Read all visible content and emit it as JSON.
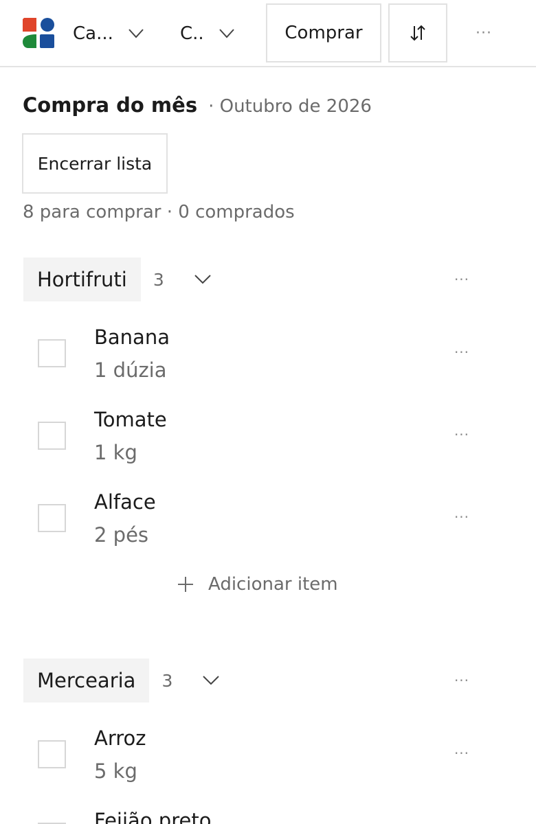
{
  "header": {
    "dropdown1_label": "Ca...",
    "dropdown2_label": "C..",
    "buy_button": "Comprar",
    "sort_icon": "sort-icon",
    "more_label": "···"
  },
  "list": {
    "title": "Compra do mês",
    "subtitle": "· Outubro de 2026",
    "close_button": "Encerrar lista",
    "summary": "8 para comprar · 0 comprados"
  },
  "groups": [
    {
      "name": "Hortifruti",
      "count": "3",
      "items": [
        {
          "name": "Banana",
          "qty": "1 dúzia"
        },
        {
          "name": "Tomate",
          "qty": "1 kg"
        },
        {
          "name": "Alface",
          "qty": "2 pés"
        }
      ],
      "add_label": "Adicionar item"
    },
    {
      "name": "Mercearia",
      "count": "3",
      "items": [
        {
          "name": "Arroz",
          "qty": "5 kg"
        },
        {
          "name": "Feijão preto",
          "qty": ""
        }
      ]
    }
  ],
  "colors": {
    "logo_red": "#E0452B",
    "logo_blue": "#1A4F9C",
    "logo_green": "#1E8A3A"
  }
}
